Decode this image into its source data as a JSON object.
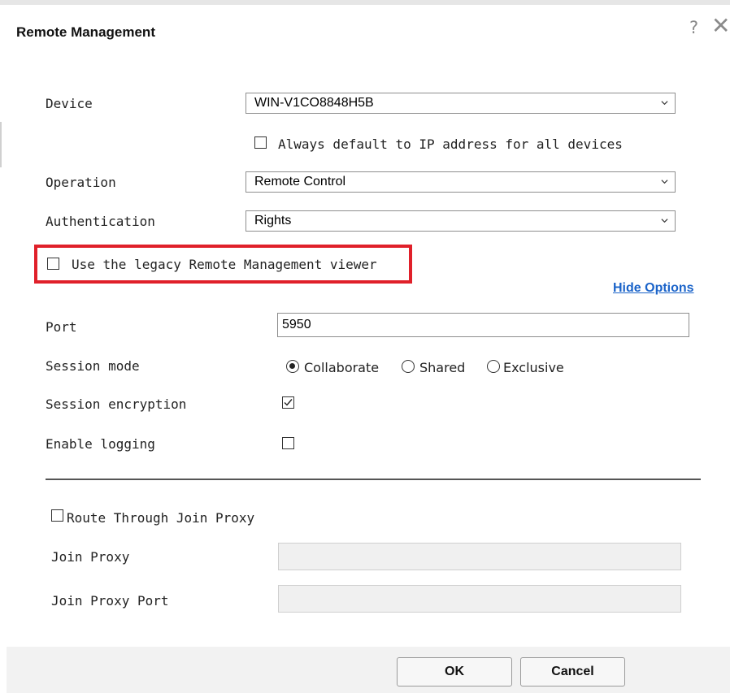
{
  "dialog": {
    "title": "Remote Management",
    "help_icon": "question-mark",
    "close_icon": "close-x"
  },
  "form": {
    "device": {
      "label": "Device",
      "value": "WIN-V1CO8848H5B"
    },
    "ip_default": {
      "label": "Always default to IP address for all devices",
      "checked": false
    },
    "operation": {
      "label": "Operation",
      "value": "Remote Control"
    },
    "authentication": {
      "label": "Authentication",
      "value": "Rights"
    },
    "legacy_viewer": {
      "label": "Use the legacy Remote Management viewer",
      "checked": false,
      "highlight_color": "#e0202a"
    },
    "hide_options": "Hide Options",
    "port": {
      "label": "Port",
      "value": "5950"
    },
    "session_mode": {
      "label": "Session mode",
      "options": [
        "Collaborate",
        "Shared",
        "Exclusive"
      ],
      "selected": "Collaborate"
    },
    "session_encryption": {
      "label": "Session encryption",
      "checked": true
    },
    "enable_logging": {
      "label": "Enable logging",
      "checked": false
    },
    "route_proxy": {
      "label": "Route Through Join Proxy",
      "checked": false
    },
    "join_proxy": {
      "label": "Join Proxy",
      "value": ""
    },
    "join_proxy_port": {
      "label": "Join Proxy Port",
      "value": ""
    }
  },
  "buttons": {
    "ok": "OK",
    "cancel": "Cancel"
  },
  "colors": {
    "link": "#1a63c9",
    "highlight": "#e0202a"
  }
}
